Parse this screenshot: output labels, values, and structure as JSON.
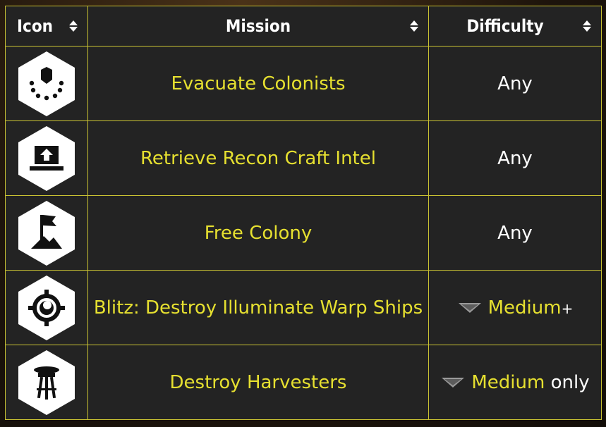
{
  "table": {
    "headers": [
      {
        "label": "Icon"
      },
      {
        "label": "Mission"
      },
      {
        "label": "Difficulty"
      }
    ],
    "rows": [
      {
        "icon": "evacuate-colonists-icon",
        "mission": "Evacuate Colonists",
        "difficulty": "Any"
      },
      {
        "icon": "retrieve-intel-icon",
        "mission": "Retrieve Recon Craft Intel",
        "difficulty": "Any"
      },
      {
        "icon": "free-colony-flag-icon",
        "mission": "Free Colony",
        "difficulty": "Any"
      },
      {
        "icon": "crosshair-target-icon",
        "mission": "Blitz: Destroy Illuminate Warp Ships",
        "difficulty_level": "Medium",
        "difficulty_suffix": "+"
      },
      {
        "icon": "harvester-stool-icon",
        "mission": "Destroy Harvesters",
        "difficulty_level": "Medium",
        "difficulty_suffix": " only"
      }
    ]
  },
  "colors": {
    "border": "#c9c232",
    "mission_text": "#e6e030",
    "cell_bg": "#232323",
    "header_text": "#ffffff"
  }
}
